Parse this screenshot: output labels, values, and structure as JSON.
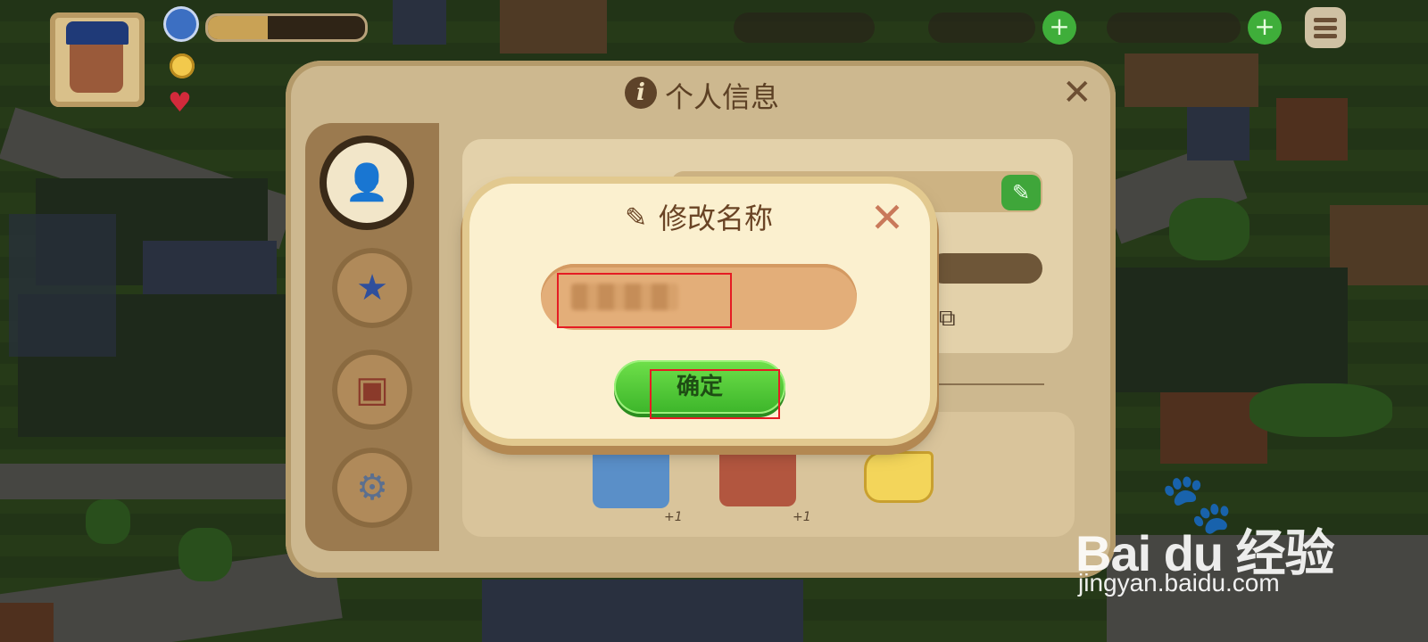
{
  "info_panel": {
    "title": "个人信息",
    "info_icon": "info-icon",
    "close_icon": "close-icon",
    "side_tabs": [
      {
        "name": "profile",
        "icon": "profile-icon",
        "glyph": "👤"
      },
      {
        "name": "badge",
        "icon": "badge-icon",
        "glyph": "★"
      },
      {
        "name": "shop",
        "icon": "shop-icon",
        "glyph": "▣"
      },
      {
        "name": "settings",
        "icon": "gear-icon",
        "glyph": "⚙"
      }
    ],
    "rewards": [
      {
        "bonus": "+1"
      },
      {
        "bonus": "+1"
      }
    ]
  },
  "rename_dialog": {
    "title": "修改名称",
    "pencil_icon": "pencil-icon",
    "close_icon": "close-icon",
    "close_glyph": "✕",
    "confirm_label": "确定"
  },
  "watermark": {
    "brand": "Bai du 经验",
    "url": "jingyan.baidu.com"
  },
  "colors": {
    "dialog_bg": "#fbf0cf",
    "confirm_green": "#4fc736",
    "highlight_red": "#e51c23"
  }
}
